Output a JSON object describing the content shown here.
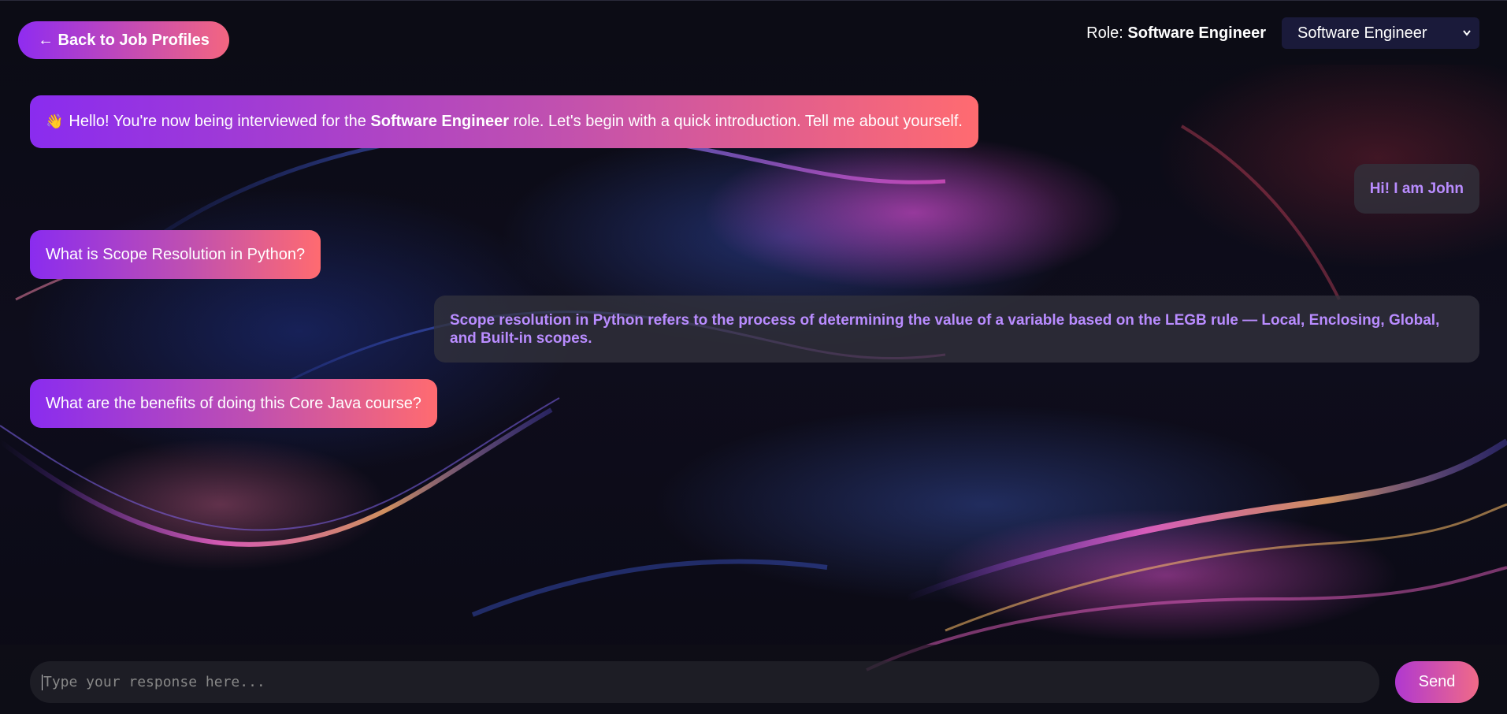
{
  "header": {
    "back_label": "← Back to Job Profiles",
    "role_prefix": "Role:",
    "role_value": "Software Engineer",
    "role_select_value": "Software Engineer"
  },
  "messages": [
    {
      "sender": "bot",
      "emoji": "👋",
      "pre": "Hello! You're now being interviewed for the",
      "bold": "Software Engineer",
      "post": "role. Let's begin with a quick introduction. Tell me about yourself."
    },
    {
      "sender": "user",
      "text": "Hi! I am John"
    },
    {
      "sender": "bot",
      "text": "What is Scope Resolution in Python?"
    },
    {
      "sender": "user",
      "text": "Scope resolution in Python refers to the process of determining the value of a variable based on the LEGB rule — Local, Enclosing, Global, and Built-in scopes."
    },
    {
      "sender": "bot",
      "text": "What are the benefits of doing this Core Java course?"
    }
  ],
  "composer": {
    "placeholder": "Type your response here...",
    "send_label": "Send"
  },
  "colors": {
    "accent_start": "#8f2cf0",
    "accent_end": "#f36680",
    "user_text": "#b98cff"
  }
}
